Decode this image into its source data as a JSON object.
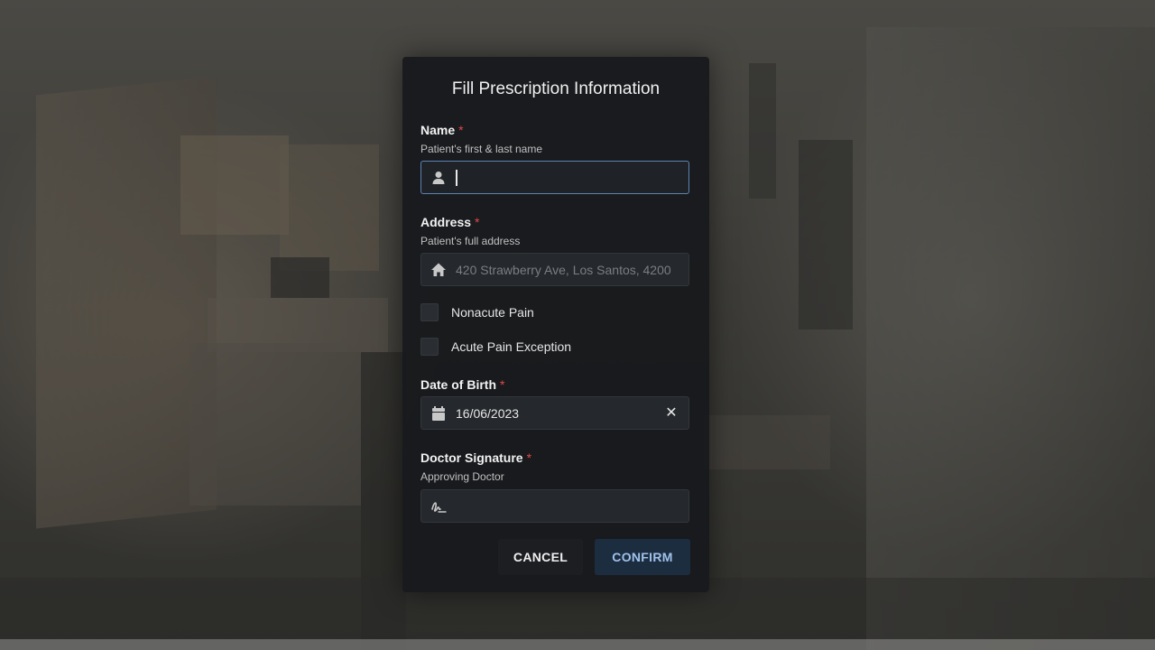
{
  "modal": {
    "title": "Fill Prescription Information",
    "required_marker": "*",
    "name": {
      "label": "Name",
      "description": "Patient's first & last name",
      "value": "",
      "icon": "person-icon"
    },
    "address": {
      "label": "Address",
      "description": "Patient's full address",
      "placeholder": "420 Strawberry Ave, Los Santos, 4200",
      "icon": "home-icon"
    },
    "checkboxes": [
      {
        "label": "Nonacute Pain",
        "checked": false
      },
      {
        "label": "Acute Pain Exception",
        "checked": false
      }
    ],
    "date_of_birth": {
      "label": "Date of Birth",
      "value": "16/06/2023",
      "icon": "calendar-icon",
      "clear_glyph": "✕"
    },
    "doctor_signature": {
      "label": "Doctor Signature",
      "description": "Approving Doctor",
      "value": "",
      "icon": "signature-icon"
    },
    "buttons": {
      "cancel": "CANCEL",
      "confirm": "CONFIRM"
    }
  },
  "colors": {
    "modal_bg": "#181a1d",
    "field_bg": "#25282c",
    "focus_border": "#5d83b3",
    "required": "#e04848",
    "confirm_bg": "#1d2d40",
    "confirm_text": "#9fc3ec"
  }
}
